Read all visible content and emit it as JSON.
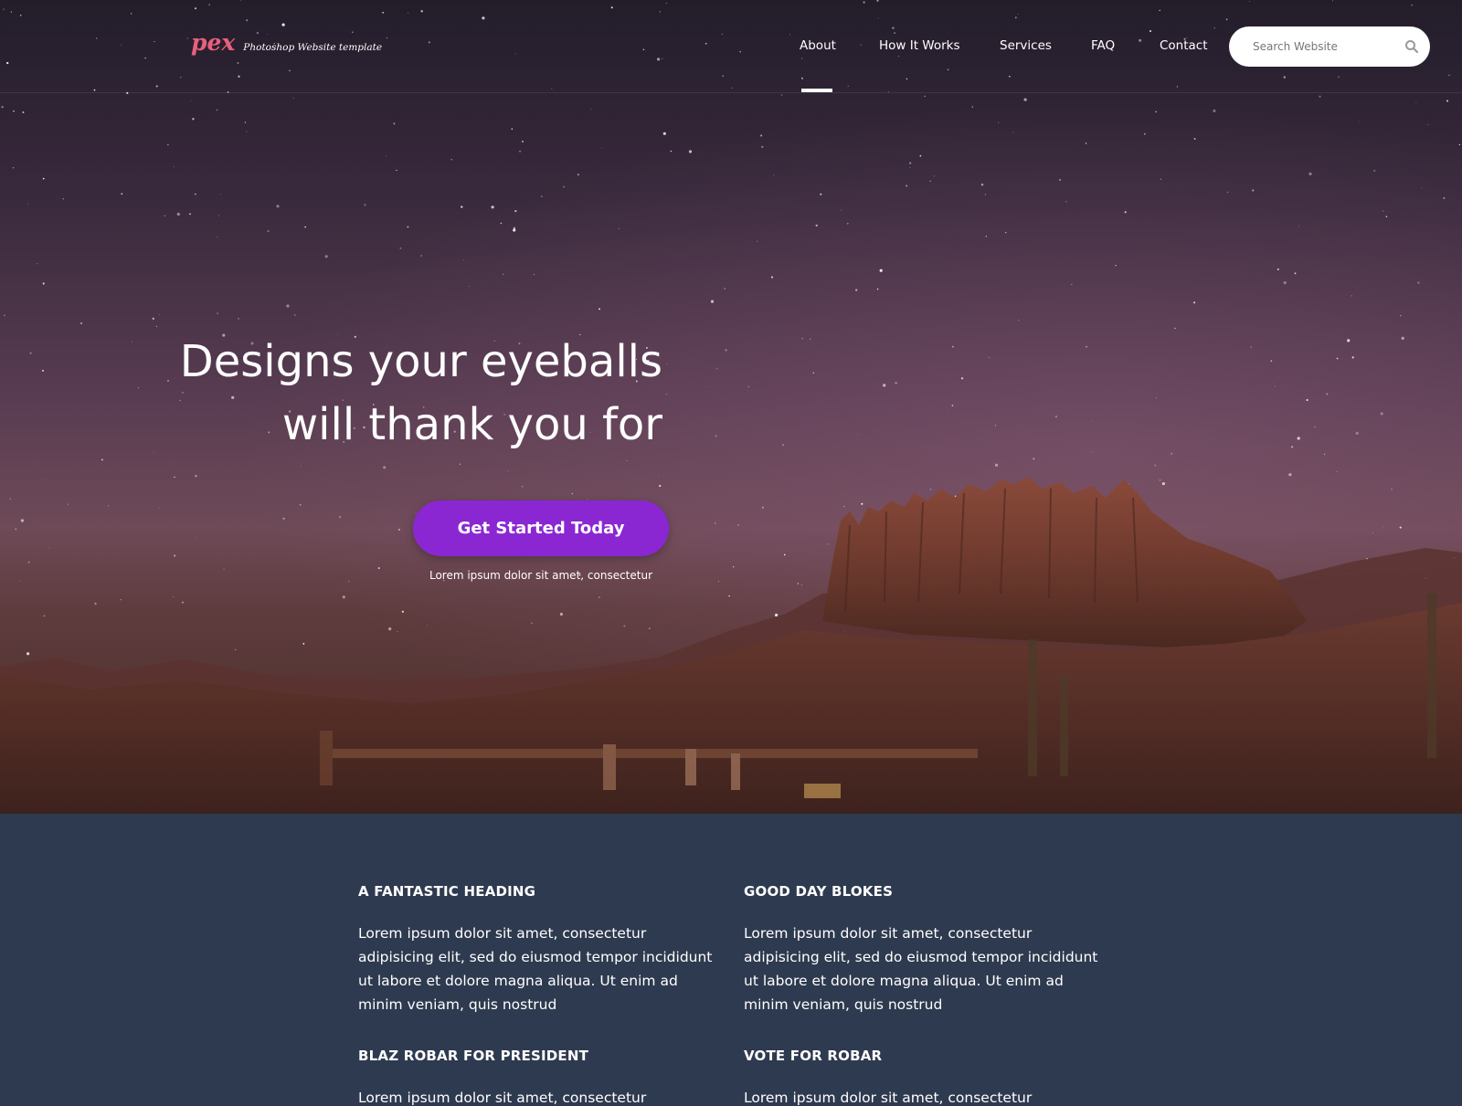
{
  "brand": {
    "logo": "pex",
    "tagline": "Photoshop Website template",
    "logo_color": "#e8607c"
  },
  "nav": {
    "items": [
      {
        "label": "About",
        "active": true
      },
      {
        "label": "How It Works"
      },
      {
        "label": "Services"
      },
      {
        "label": "FAQ"
      },
      {
        "label": "Contact"
      }
    ]
  },
  "search": {
    "placeholder": "Search Website",
    "icon": "search-icon"
  },
  "hero": {
    "title_line1": "Designs your eyeballs",
    "title_line2": "will thank you for",
    "cta_label": "Get Started Today",
    "cta_color": "#8a27d3",
    "caption": "Lorem ipsum dolor sit amet, consectetur"
  },
  "features": [
    {
      "heading": "A FANTASTIC HEADING",
      "text": "Lorem ipsum dolor sit amet, consectetur adipisicing elit, sed do eiusmod tempor incididunt ut labore et dolore magna aliqua. Ut enim ad minim veniam, quis nostrud"
    },
    {
      "heading": "GOOD DAY BLOKES",
      "text": "Lorem ipsum dolor sit amet, consectetur adipisicing elit, sed do eiusmod tempor incididunt ut labore et dolore magna aliqua. Ut enim ad minim veniam, quis nostrud"
    },
    {
      "heading": "BLAZ ROBAR FOR PRESIDENT",
      "text": "Lorem ipsum dolor sit amet, consectetur adipisicing elit,"
    },
    {
      "heading": "VOTE FOR ROBAR",
      "text": "Lorem ipsum dolor sit amet, consectetur adipisicing elit,"
    }
  ],
  "colors": {
    "content_bg": "#2e3a4f"
  }
}
